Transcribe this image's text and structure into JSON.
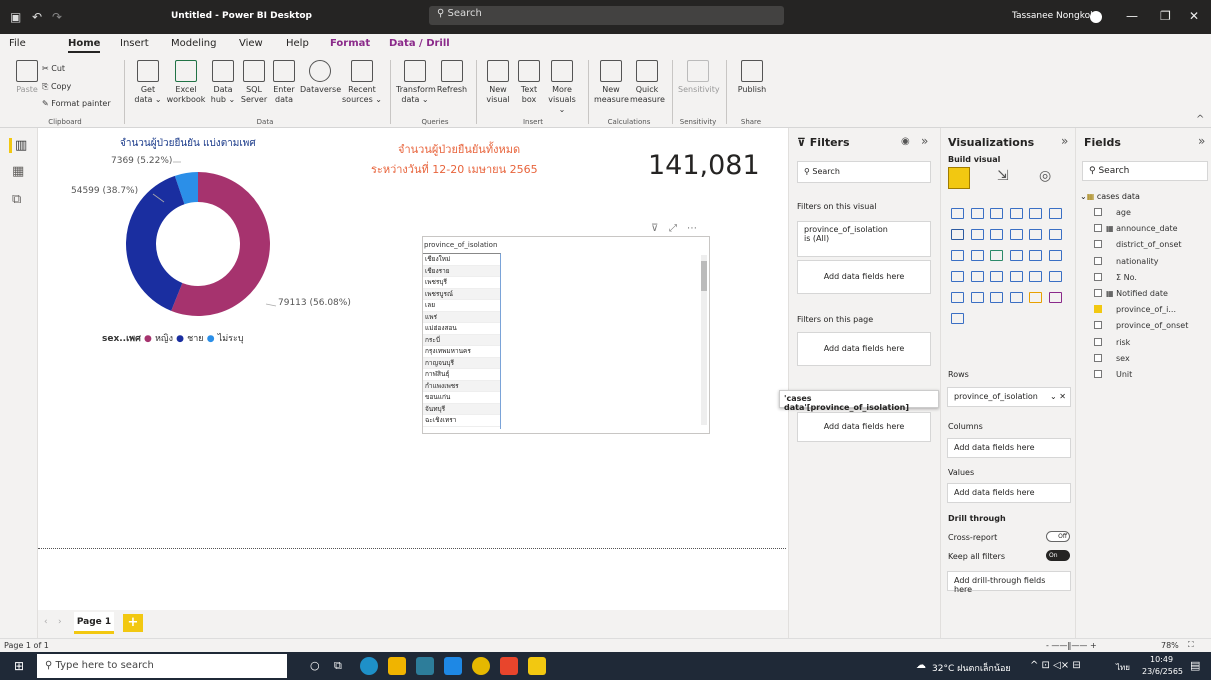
{
  "titlebar": {
    "title": "Untitled - Power BI Desktop",
    "search": "Search",
    "user": "Tassanee Nongkok"
  },
  "menu": [
    "File",
    "Home",
    "Insert",
    "Modeling",
    "View",
    "Help",
    "Format",
    "Data / Drill"
  ],
  "ribbon": {
    "paste": "Paste",
    "cut": "Cut",
    "copy": "Copy",
    "format_painter": "Format painter",
    "get_data": "Get data ⌄",
    "excel": "Excel workbook",
    "hub": "Data hub ⌄",
    "sql": "SQL Server",
    "enter": "Enter data",
    "dataverse": "Dataverse",
    "recent": "Recent sources ⌄",
    "transform": "Transform data ⌄",
    "refresh": "Refresh",
    "new_visual": "New visual",
    "text_box": "Text box",
    "more_visuals": "More visuals ⌄",
    "new_measure": "New measure",
    "quick_measure": "Quick measure",
    "sensitivity": "Sensitivity",
    "publish": "Publish",
    "groups": {
      "clipboard": "Clipboard",
      "data": "Data",
      "queries": "Queries",
      "insert": "Insert",
      "calculations": "Calculations",
      "sensitivity": "Sensitivity",
      "share": "Share"
    }
  },
  "donut": {
    "title": "จำนวนผู้ป่วยยืนยัน แบ่งตามเพศ",
    "labels": [
      "7369 (5.22%)",
      "54599 (38.7%)",
      "79113 (56.08%)"
    ],
    "legend_title": "sex..เพศ",
    "legend": [
      "หญิง",
      "ชาย",
      "ไม่ระบุ"
    ],
    "colors": [
      "#a6336e",
      "#1a2ea0",
      "#2b8fe8"
    ],
    "chart_data": {
      "type": "pie",
      "categories": [
        "หญิง",
        "ชาย",
        "ไม่ระบุ"
      ],
      "values": [
        79113,
        54599,
        7369
      ],
      "percent": [
        56.08,
        38.7,
        5.22
      ],
      "title": "จำนวนผู้ป่วยยืนยัน แบ่งตามเพศ"
    }
  },
  "headline": {
    "line1": "จำนวนผู้ป่วยยืนยันทั้งหมด",
    "line2": "ระหว่างวันที่ 12-20 เมษายน 2565",
    "color": "#e8643c"
  },
  "card": {
    "value": "141,081"
  },
  "table": {
    "header": "province_of_isolation",
    "rows": [
      "เชียงใหม่",
      "เชียงราย",
      "เพชรบุรี",
      "เพชรบูรณ์",
      "เลย",
      "แพร่",
      "แม่ฮ่องสอน",
      "กระบี่",
      "กรุงเทพมหานคร",
      "กาญจนบุรี",
      "กาฬสินธุ์",
      "กำแพงเพชร",
      "ขอนแก่น",
      "จันทบุรี",
      "ฉะเชิงเทรา"
    ]
  },
  "page_tab": "Page 1",
  "status": "Page 1 of 1",
  "zoom": "78%",
  "filters": {
    "title": "Filters",
    "search": "Search",
    "on_visual": "Filters on this visual",
    "filter_field": "province_of_isolation",
    "filter_val": "is (All)",
    "add": "Add data fields here",
    "on_page": "Filters on this page",
    "on_all": "Add data fields here"
  },
  "drag_tooltip": "'cases data'[province_of_isolation]",
  "viz": {
    "title": "Visualizations",
    "build": "Build visual",
    "rows": "Rows",
    "rows_field": "province_of_isolation",
    "columns": "Columns",
    "values": "Values",
    "add": "Add data fields here",
    "drill": "Drill through",
    "cross": "Cross-report",
    "keep": "Keep all filters",
    "off": "Off",
    "on": "On",
    "add_drill": "Add drill-through fields here"
  },
  "fields": {
    "title": "Fields",
    "search": "Search",
    "table": "cases data",
    "items": [
      "age",
      "announce_date",
      "district_of_onset",
      "nationality",
      "No.",
      "Notified date",
      "province_of_i...",
      "province_of_onset",
      "risk",
      "sex",
      "Unit"
    ]
  },
  "taskbar": {
    "search": "Type here to search",
    "weather": "32°C ฝนตกเล็กน้อย",
    "lang": "ไทย",
    "time": "10:49",
    "date": "23/6/2565"
  }
}
